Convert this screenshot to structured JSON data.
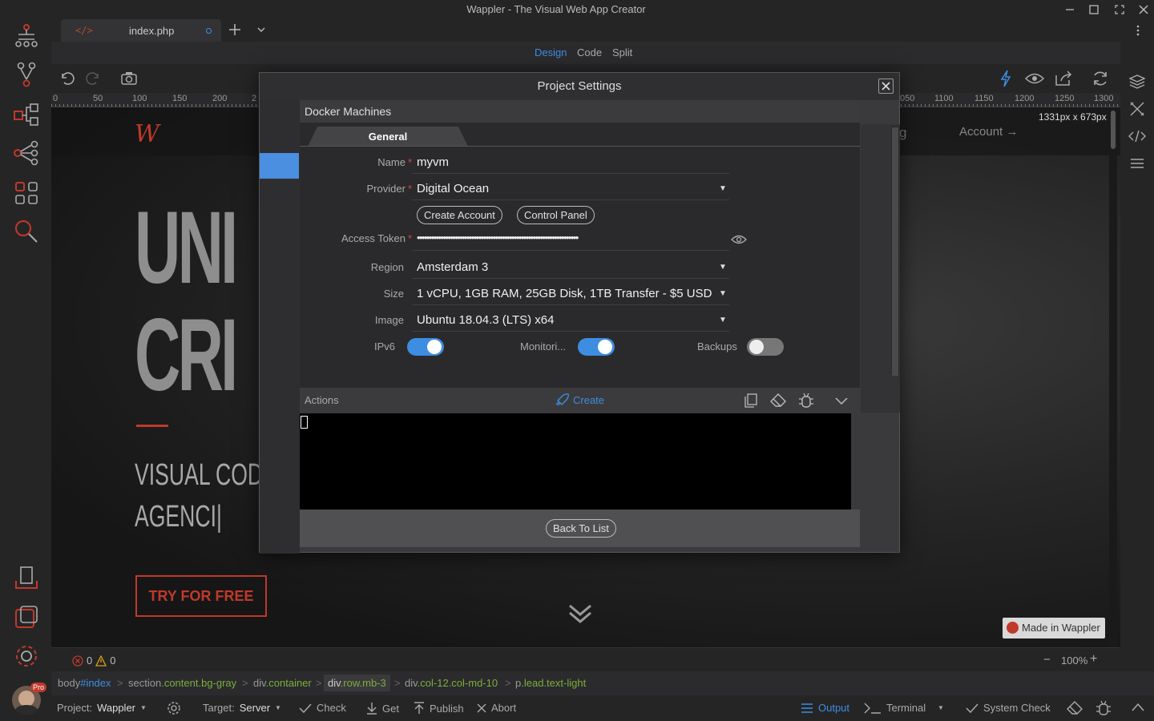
{
  "window": {
    "title": "Wappler - The Visual Web App Creator"
  },
  "tabs": {
    "file": "index.php"
  },
  "modes": {
    "design": "Design",
    "code": "Code",
    "split": "Split",
    "active": "Design"
  },
  "ruler": {
    "labels": [
      "0",
      "50",
      "100",
      "150",
      "200",
      "2",
      "050",
      "1100",
      "1150",
      "1200",
      "1250",
      "1300"
    ]
  },
  "canvas": {
    "size_badge": "1331px x 673px",
    "logo": "W",
    "nav_partial": "g",
    "nav_account": "Account →",
    "hero_line1": "UNI",
    "hero_line2": "CRI",
    "sub_line1": "VISUAL COD",
    "sub_line2": "AGENCI|",
    "cta": "TRY FOR FREE",
    "made_in": "Made in Wappler"
  },
  "dialog": {
    "title": "Project Settings",
    "panel_title": "Docker Machines",
    "tab": "General",
    "fields": {
      "name": {
        "label": "Name",
        "value": "myvm"
      },
      "provider": {
        "label": "Provider",
        "value": "Digital Ocean",
        "create_account": "Create Account",
        "control_panel": "Control Panel"
      },
      "access_token": {
        "label": "Access Token",
        "value": "••••••••••••••••••••••••••••••••••••••••••••••••••••••••••••••••••••"
      },
      "region": {
        "label": "Region",
        "value": "Amsterdam 3"
      },
      "size": {
        "label": "Size",
        "value": "1 vCPU, 1GB RAM, 25GB Disk, 1TB Transfer - $5 USD"
      },
      "image": {
        "label": "Image",
        "value": "Ubuntu 18.04.3 (LTS) x64"
      }
    },
    "toggles": {
      "ipv6": {
        "label": "IPv6",
        "on": true
      },
      "monitoring": {
        "label": "Monitori...",
        "on": true
      },
      "backups": {
        "label": "Backups",
        "on": false
      }
    },
    "actions": {
      "label": "Actions",
      "create": "Create"
    },
    "back_to_list": "Back To List"
  },
  "status": {
    "errors": "0",
    "warnings": "0",
    "zoom": "100%"
  },
  "breadcrumb": [
    {
      "tag": "body",
      "sep": "#",
      "sel": "index",
      "type": "id"
    },
    {
      "tag": "section",
      "sep": ".",
      "sel": "content.bg-gray",
      "type": "cls"
    },
    {
      "tag": "div",
      "sep": ".",
      "sel": "container",
      "type": "cls"
    },
    {
      "tag": "div",
      "sep": ".",
      "sel": "row.mb-3",
      "type": "cls"
    },
    {
      "tag": "div",
      "sep": ".",
      "sel": "col-12.col-md-10",
      "type": "cls"
    },
    {
      "tag": "p",
      "sep": ".",
      "sel": "lead.text-light",
      "type": "cls"
    }
  ],
  "bottombar": {
    "project_label": "Project:",
    "project_value": "Wappler",
    "target_label": "Target:",
    "target_value": "Server",
    "check": "Check",
    "get": "Get",
    "publish": "Publish",
    "abort": "Abort",
    "output": "Output",
    "terminal": "Terminal",
    "system_check": "System Check",
    "pro_badge": "Pro"
  },
  "colors": {
    "accent": "#3d8de0",
    "brand": "#c0392b",
    "dialog_bg": "#2a2a2c"
  }
}
